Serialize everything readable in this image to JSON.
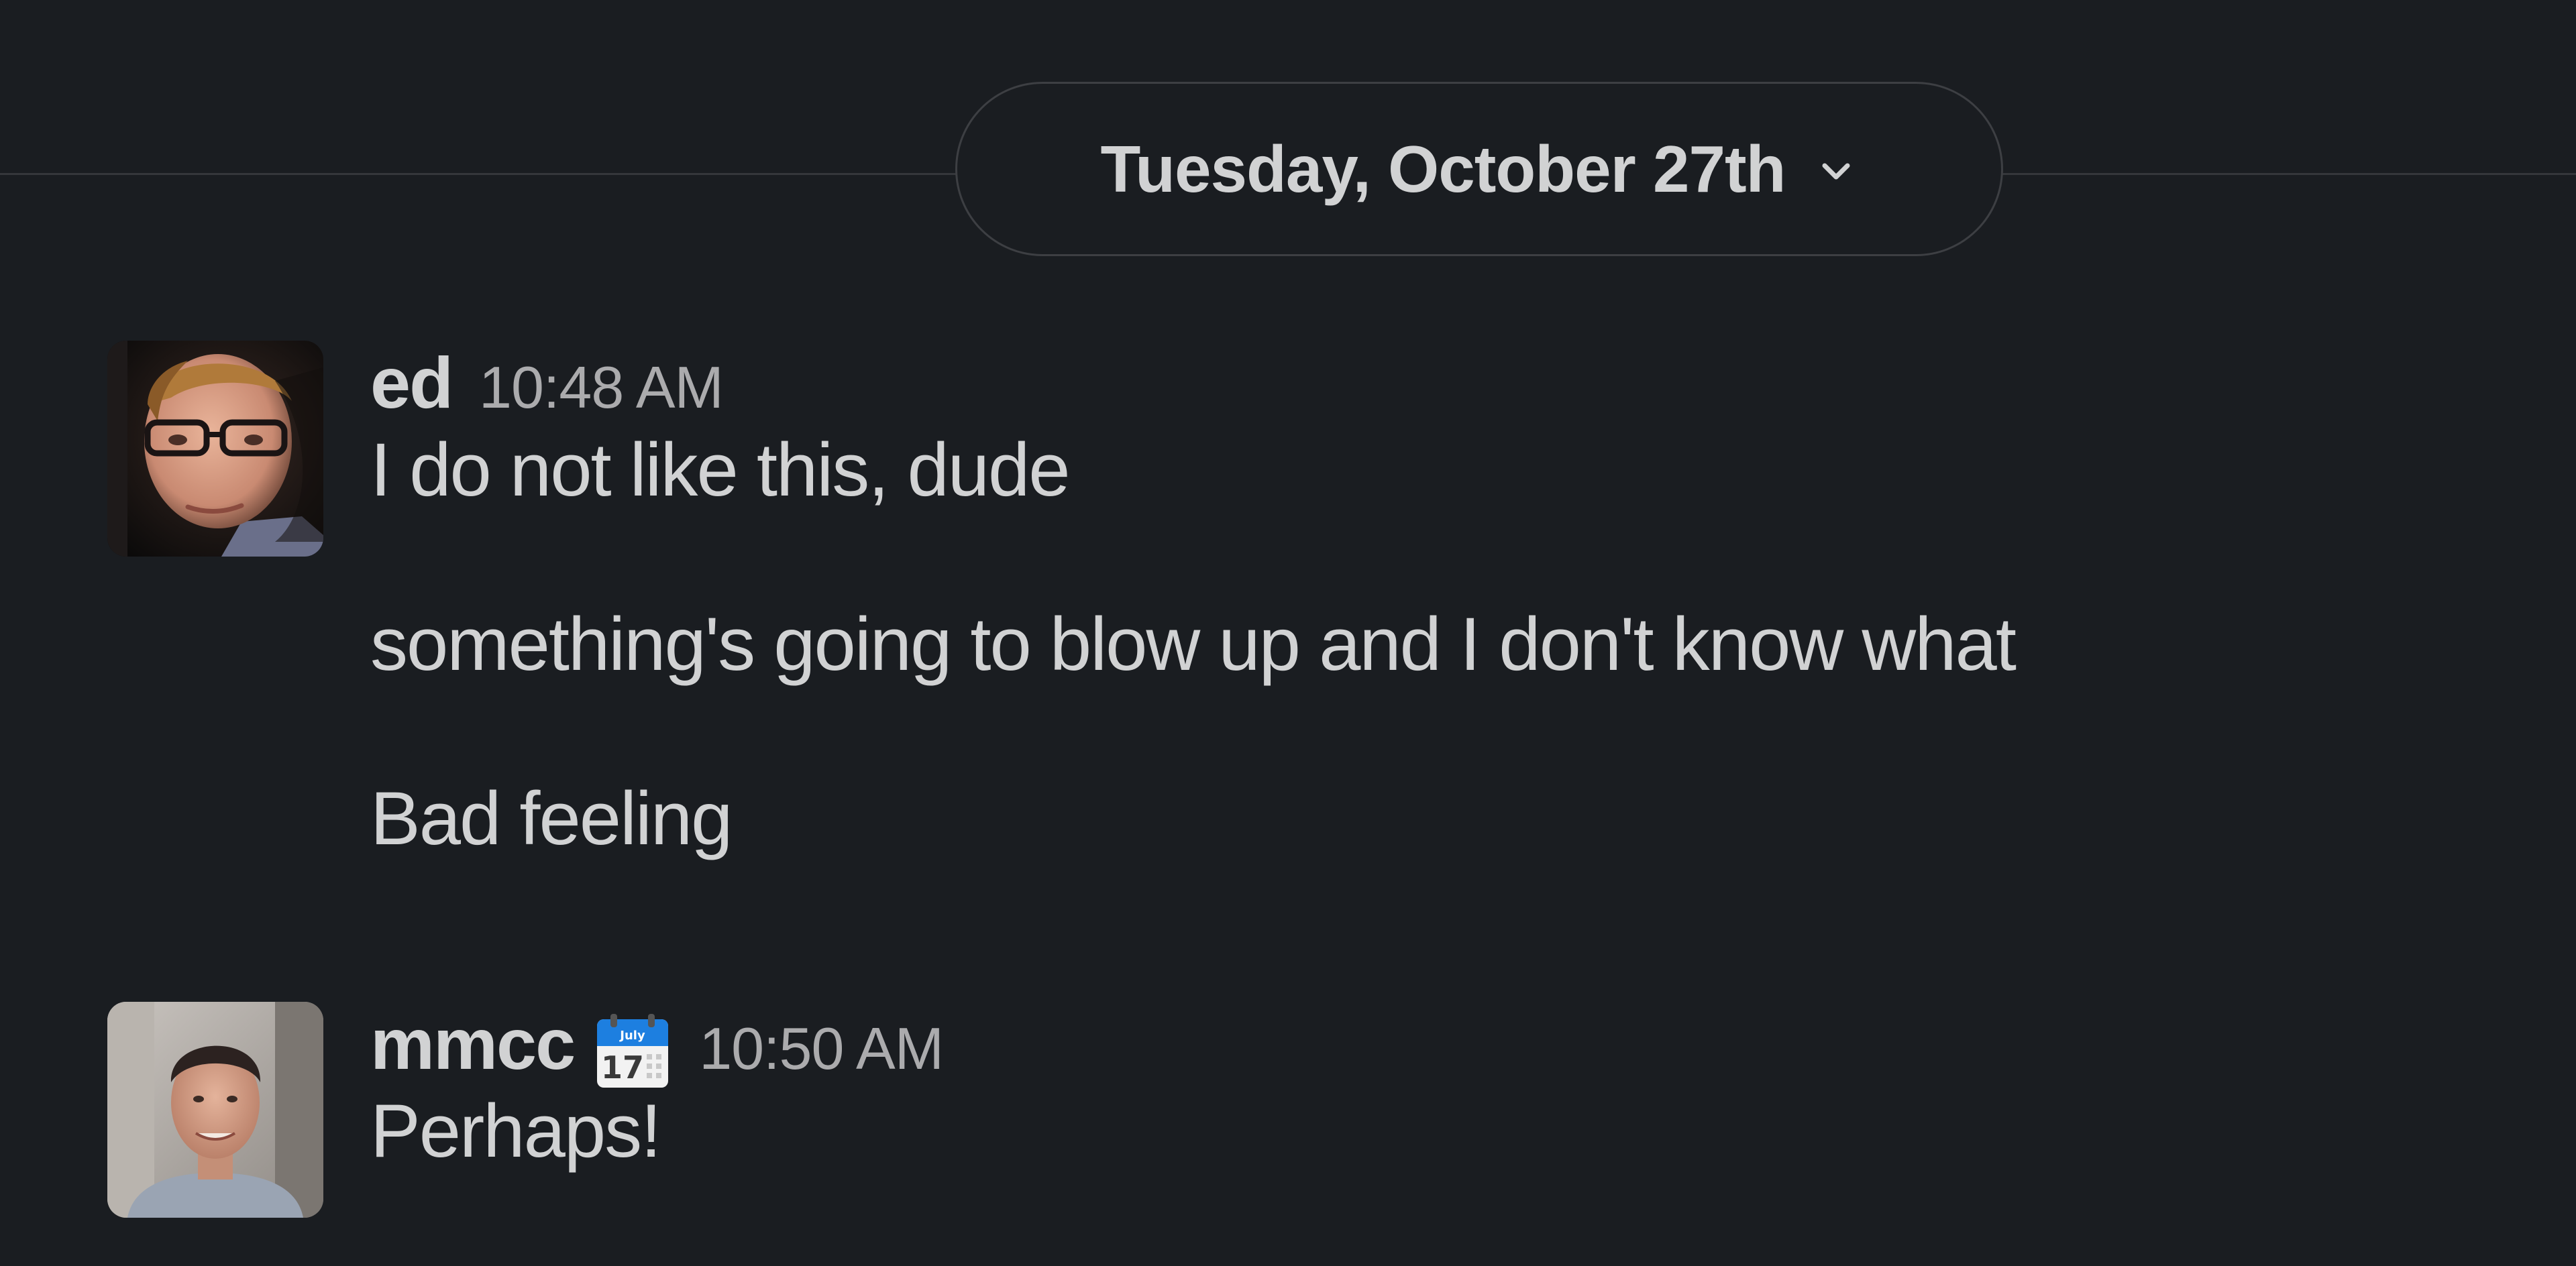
{
  "date_divider": {
    "label": "Tuesday, October 27th",
    "icon": "chevron-down-icon"
  },
  "messages": [
    {
      "sender": "ed",
      "time": "10:48 AM",
      "avatar_icon": "user-avatar-ed",
      "lines": [
        "I do not like this, dude",
        "something's going to blow up and I don't know what",
        "Bad feeling"
      ]
    },
    {
      "sender": "mmcc",
      "status_emoji": "calendar-icon",
      "status_emoji_text": {
        "month": "July",
        "day": "17"
      },
      "time": "10:50 AM",
      "avatar_icon": "user-avatar-mmcc",
      "lines": [
        "Perhaps!"
      ]
    }
  ],
  "colors": {
    "background": "#1a1d21",
    "text": "#d1d2d3",
    "muted": "#ababad",
    "divider": "#35373b",
    "calendar_blue": "#1d7fe0"
  }
}
